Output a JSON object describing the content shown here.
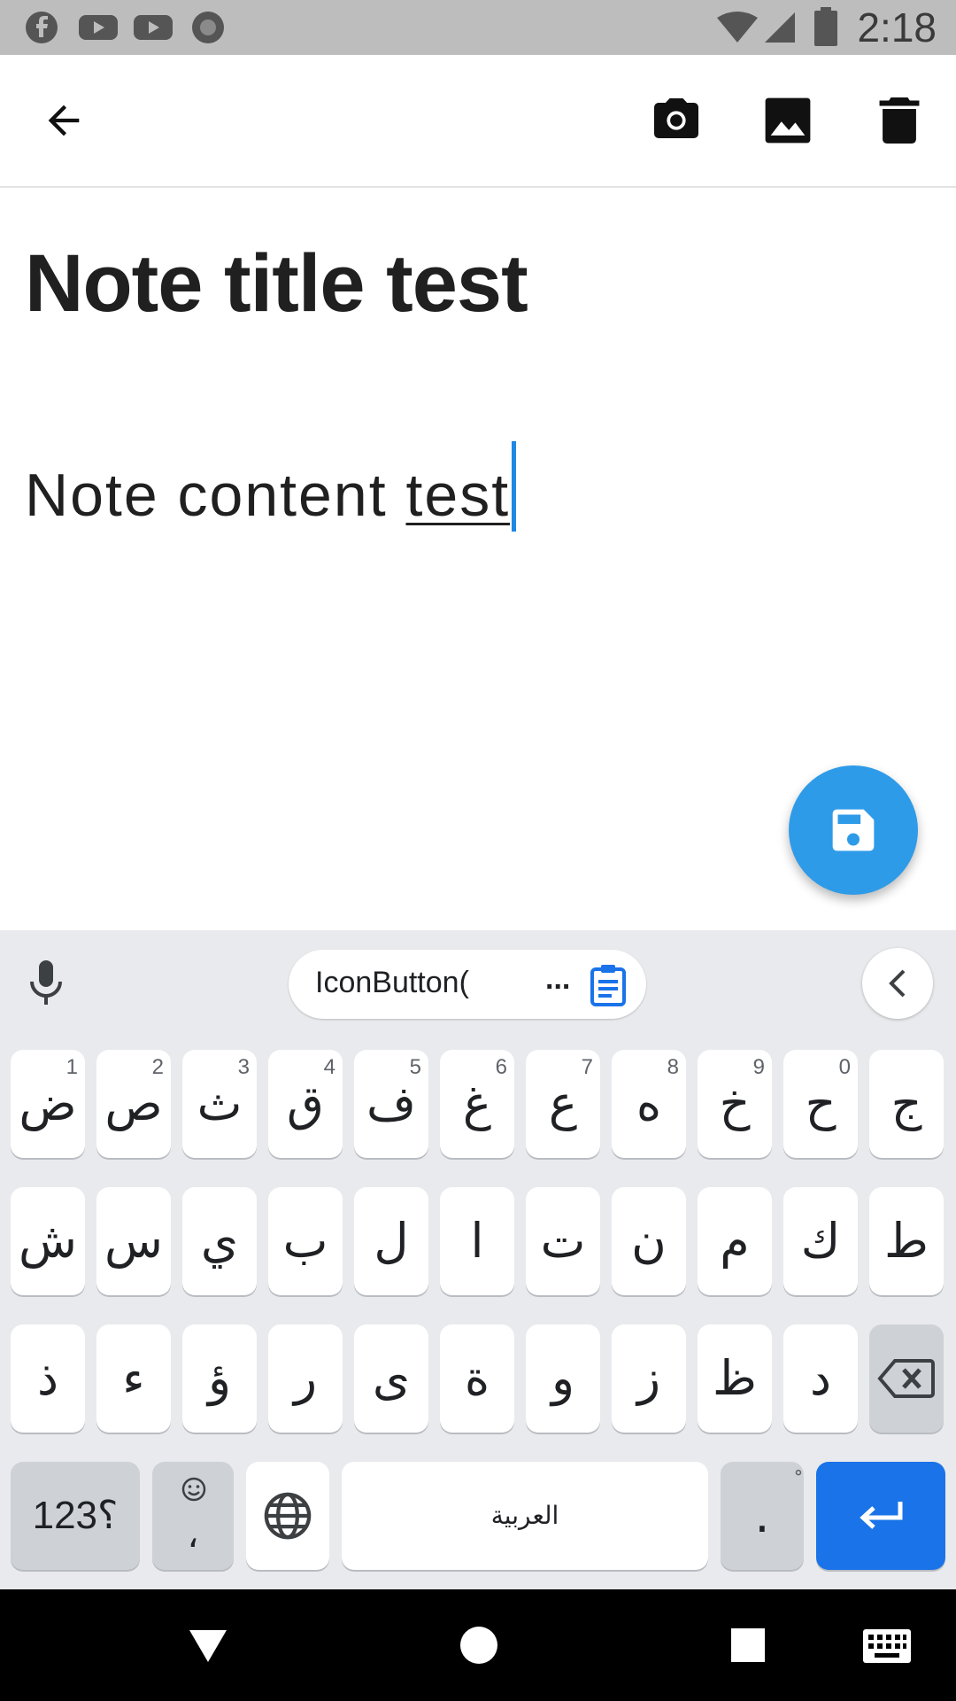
{
  "status_bar": {
    "time": "2:18",
    "left_icons": [
      "facebook-icon",
      "youtube-icon",
      "youtube-icon",
      "record-icon"
    ],
    "right_icons": [
      "wifi-icon",
      "cell-signal-icon",
      "battery-icon"
    ]
  },
  "app_bar": {
    "icons": [
      "back-arrow-icon",
      "camera-icon",
      "image-icon",
      "delete-icon"
    ]
  },
  "note": {
    "title": "Note title test",
    "content_prefix": "Note content ",
    "content_underlined": "test"
  },
  "fab": {
    "icon": "save-icon",
    "color": "#2e9be8"
  },
  "keyboard": {
    "clipboard_text": "IconButton(",
    "clipboard_ellipsis": "...",
    "rows": [
      [
        {
          "label": "ض",
          "hint": "1"
        },
        {
          "label": "ص",
          "hint": "2"
        },
        {
          "label": "ث",
          "hint": "3"
        },
        {
          "label": "ق",
          "hint": "4"
        },
        {
          "label": "ف",
          "hint": "5"
        },
        {
          "label": "غ",
          "hint": "6"
        },
        {
          "label": "ع",
          "hint": "7"
        },
        {
          "label": "ه",
          "hint": "8"
        },
        {
          "label": "خ",
          "hint": "9"
        },
        {
          "label": "ح",
          "hint": "0"
        },
        {
          "label": "ج",
          "hint": ""
        }
      ],
      [
        {
          "label": "ش"
        },
        {
          "label": "س"
        },
        {
          "label": "ي"
        },
        {
          "label": "ب"
        },
        {
          "label": "ل"
        },
        {
          "label": "ا"
        },
        {
          "label": "ت"
        },
        {
          "label": "ن"
        },
        {
          "label": "م"
        },
        {
          "label": "ك"
        },
        {
          "label": "ط"
        }
      ],
      [
        {
          "label": "ذ"
        },
        {
          "label": "ء"
        },
        {
          "label": "ؤ"
        },
        {
          "label": "ر"
        },
        {
          "label": "ى"
        },
        {
          "label": "ة"
        },
        {
          "label": "و"
        },
        {
          "label": "ز"
        },
        {
          "label": "ظ"
        },
        {
          "label": "د"
        }
      ]
    ],
    "symbols_label": "؟123",
    "emoji_sub": "،",
    "space_label": "العربية",
    "period_label": ".",
    "period_hint": "ْ",
    "accent_color": "#1a73e8"
  },
  "nav_bar": {
    "icons": [
      "back-triangle-icon",
      "home-circle-icon",
      "recents-square-icon",
      "keyboard-icon"
    ]
  }
}
